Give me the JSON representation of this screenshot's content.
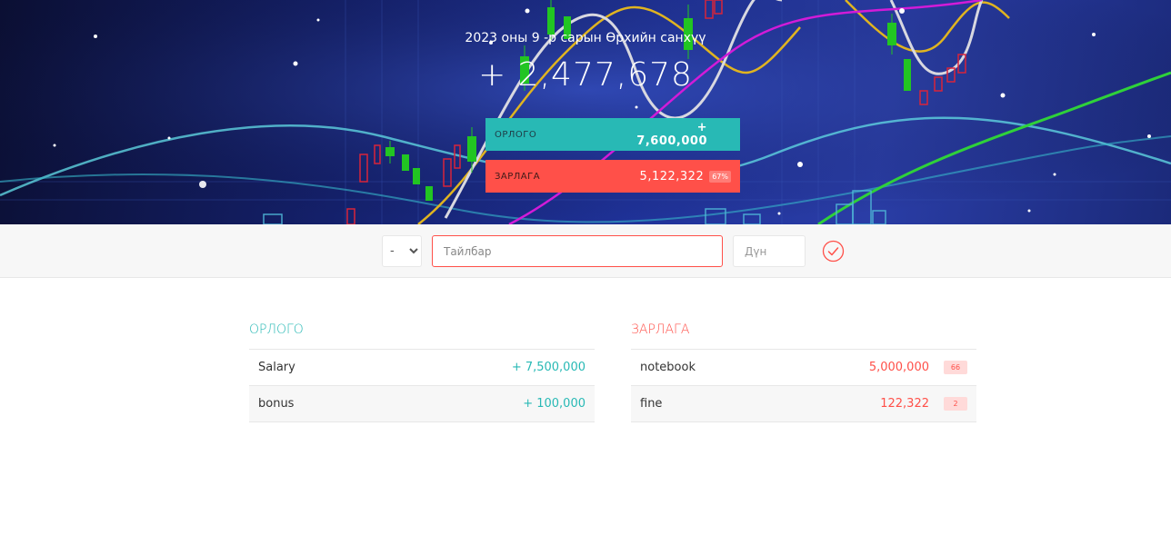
{
  "budget": {
    "title": "2023 оны 9 -р сарын Өрхийн санхүү",
    "value": "+ 2,477,678"
  },
  "summary": {
    "income_label": "ОРЛОГО",
    "income_value": "+ 7,600,000",
    "expenses_label": "ЗАРЛАГА",
    "expenses_value": "5,122,322",
    "expenses_percentage": "67%"
  },
  "add_form": {
    "type_selected": "-",
    "description_placeholder": "Тайлбар",
    "value_placeholder": "Дүн",
    "submit_icon": "check-circle-icon"
  },
  "income": {
    "title": "ОРЛОГО",
    "items": [
      {
        "description": "Salary",
        "value": "+ 7,500,000"
      },
      {
        "description": "bonus",
        "value": "+ 100,000"
      }
    ]
  },
  "expenses": {
    "title": "ЗАРЛАГА",
    "items": [
      {
        "description": "notebook",
        "value": "5,000,000",
        "percentage": "66"
      },
      {
        "description": "fine",
        "value": "122,322",
        "percentage": "2"
      }
    ]
  },
  "colors": {
    "income": "#28b9b5",
    "expenses": "#ff5049",
    "background": "#f7f7f7"
  }
}
